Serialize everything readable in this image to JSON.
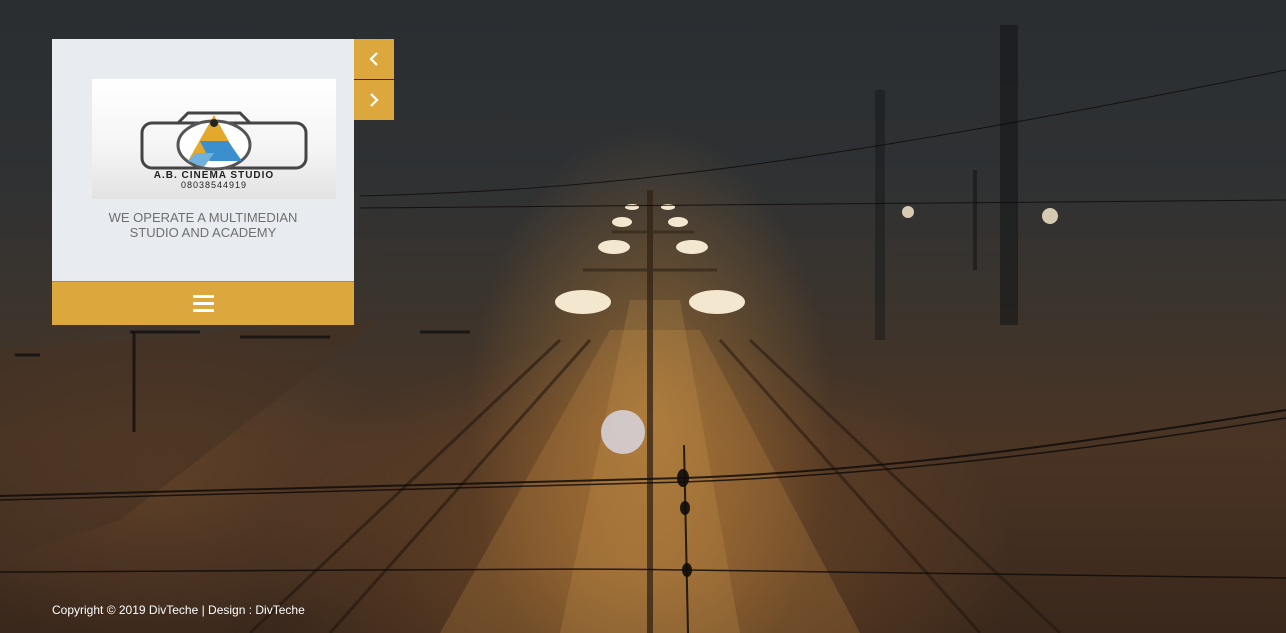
{
  "logo": {
    "studio_name": "A.B. CINEMA STUDIO",
    "phone": "08038544919"
  },
  "tagline": {
    "line1": "WE OPERATE A MULTIMEDIAN",
    "line2": "STUDIO AND ACADEMY"
  },
  "nav": {
    "menu_icon": "hamburger-icon",
    "prev_icon": "chevron-left-icon",
    "next_icon": "chevron-right-icon"
  },
  "footer": {
    "copyright": "Copyright © 2019 DivTeche | Design : DivTeche"
  },
  "colors": {
    "accent": "#dca83d",
    "panel": "#e8ebef",
    "tagline": "#6f6f6f"
  }
}
